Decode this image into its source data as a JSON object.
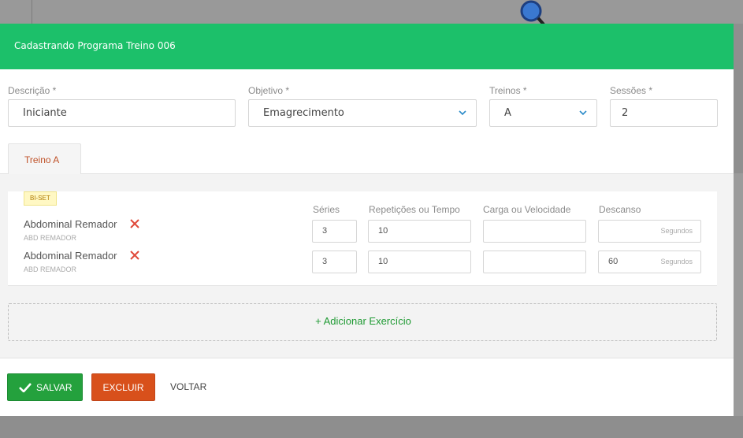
{
  "modal": {
    "title": "Cadastrando Programa Treino  006",
    "header_color": "#1cc06a"
  },
  "form": {
    "descricao": {
      "label": "Descrição *",
      "value": "Iniciante"
    },
    "objetivo": {
      "label": "Objetivo *",
      "value": "Emagrecimento"
    },
    "treinos": {
      "label": "Treinos *",
      "value": "A"
    },
    "sessoes": {
      "label": "Sessões *",
      "value": "2"
    }
  },
  "tabs": [
    {
      "label": "Treino A"
    }
  ],
  "exercise_group": {
    "badge": "BI-SET",
    "columns": [
      "Séries",
      "Repetições ou Tempo",
      "Carga ou Velocidade",
      "Descanso"
    ],
    "rows": [
      {
        "name": "Abdominal Remador",
        "code": "ABD REMADOR",
        "series": "3",
        "reps": "10",
        "carga": "",
        "descanso": "",
        "descanso_unit": "Segundos"
      },
      {
        "name": "Abdominal Remador",
        "code": "ABD REMADOR",
        "series": "3",
        "reps": "10",
        "carga": "",
        "descanso": "60",
        "descanso_unit": "Segundos"
      }
    ]
  },
  "add_exercise": "+ Adicionar Exercício",
  "buttons": {
    "save": "SALVAR",
    "delete": "EXCLUIR",
    "back": "VOLTAR"
  },
  "icons": {
    "search": "search-icon",
    "remove": "close-icon",
    "chevron": "chevron-down-icon",
    "check": "check-icon"
  },
  "colors": {
    "save": "#24a13d",
    "delete": "#d8501b",
    "tab_text": "#c0532a",
    "remove": "#e04a3a"
  }
}
